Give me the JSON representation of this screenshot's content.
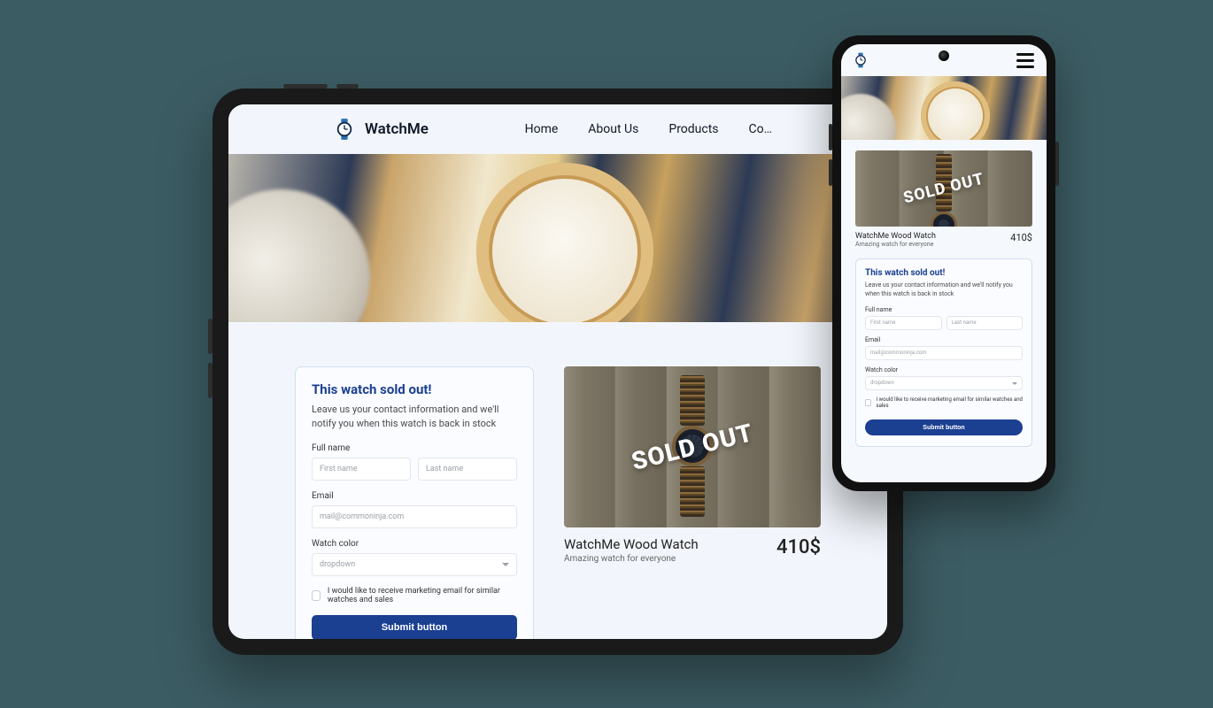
{
  "brand": {
    "name": "WatchMe"
  },
  "nav": {
    "items": [
      "Home",
      "About Us",
      "Products",
      "Co…"
    ]
  },
  "product": {
    "name": "WatchMe Wood Watch",
    "desc": "Amazing watch for everyone",
    "price": "410$",
    "sold_out_label": "SOLD OUT"
  },
  "form": {
    "title": "This watch sold out!",
    "subtitle": "Leave us your contact information and we'll notify you when this watch is back in stock",
    "full_name_label": "Full name",
    "first_name_ph": "First name",
    "last_name_ph": "Last name",
    "email_label": "Email",
    "email_ph": "mail@commoninja.com",
    "watch_color_label": "Watch color",
    "dropdown_ph": "dropdown",
    "marketing_label": "I would like to receive marketing email for similar watches and sales",
    "submit_label": "Submit button"
  }
}
